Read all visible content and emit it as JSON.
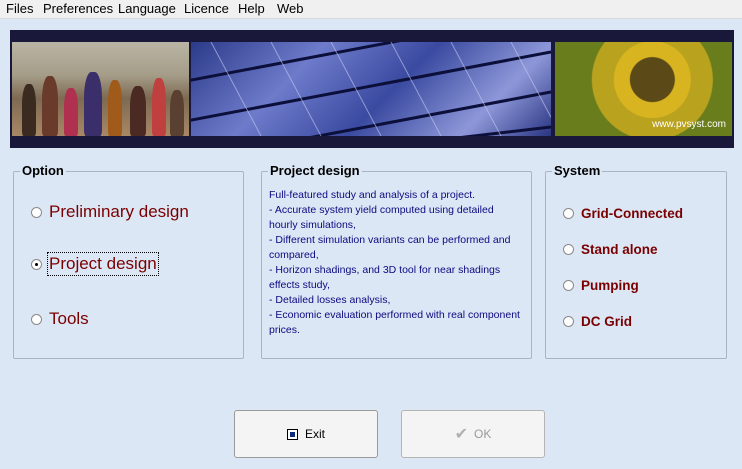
{
  "menu": [
    "Files",
    "Preferences",
    "Language",
    "Licence",
    "Help",
    "Web"
  ],
  "banner": {
    "url_text": "www.pvsyst.com"
  },
  "option": {
    "title": "Option",
    "items": [
      {
        "label": "Preliminary design",
        "checked": false
      },
      {
        "label": "Project design",
        "checked": true
      },
      {
        "label": "Tools",
        "checked": false
      }
    ]
  },
  "project": {
    "title": "Project design",
    "description": "Full-featured study and analysis of a project.\n- Accurate system yield computed using detailed hourly simulations,\n- Different simulation variants can be performed and compared,\n- Horizon shadings, and 3D tool for near shadings effects study,\n- Detailed losses analysis,\n- Economic evaluation performed with real component prices."
  },
  "system": {
    "title": "System",
    "items": [
      {
        "label": "Grid-Connected",
        "checked": false
      },
      {
        "label": "Stand alone",
        "checked": false
      },
      {
        "label": "Pumping",
        "checked": false
      },
      {
        "label": "DC Grid",
        "checked": false
      }
    ]
  },
  "buttons": {
    "exit": "Exit",
    "ok": "OK"
  },
  "icons": {
    "exit": "exit-door-icon",
    "ok": "check-icon"
  }
}
